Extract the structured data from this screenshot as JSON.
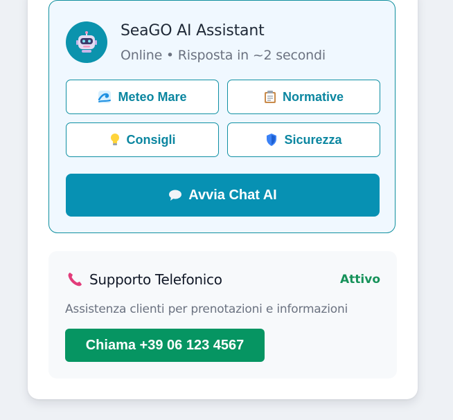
{
  "assistant": {
    "title": "SeaGO AI Assistant",
    "status_text": "Online • Risposta in ~2 secondi",
    "quick_actions": [
      {
        "label": "Meteo Mare",
        "icon": "wave-icon"
      },
      {
        "label": "Normative",
        "icon": "clipboard-icon"
      },
      {
        "label": "Consigli",
        "icon": "lightbulb-icon"
      },
      {
        "label": "Sicurezza",
        "icon": "shield-icon"
      }
    ],
    "cta_label": "Avvia Chat AI",
    "cta_icon": "speech-bubble-icon"
  },
  "phone_support": {
    "title": "Supporto Telefonico",
    "status": "Attivo",
    "description": "Assistenza clienti per prenotazioni e informazioni",
    "call_button_label": "Chiama +39 06 123 4567",
    "icon": "telephone-icon"
  },
  "colors": {
    "accent": "#0791b3",
    "card_border": "#0f8f9e",
    "card_bg": "#f0f8ff",
    "success": "#069562",
    "status_green": "#16925a"
  }
}
